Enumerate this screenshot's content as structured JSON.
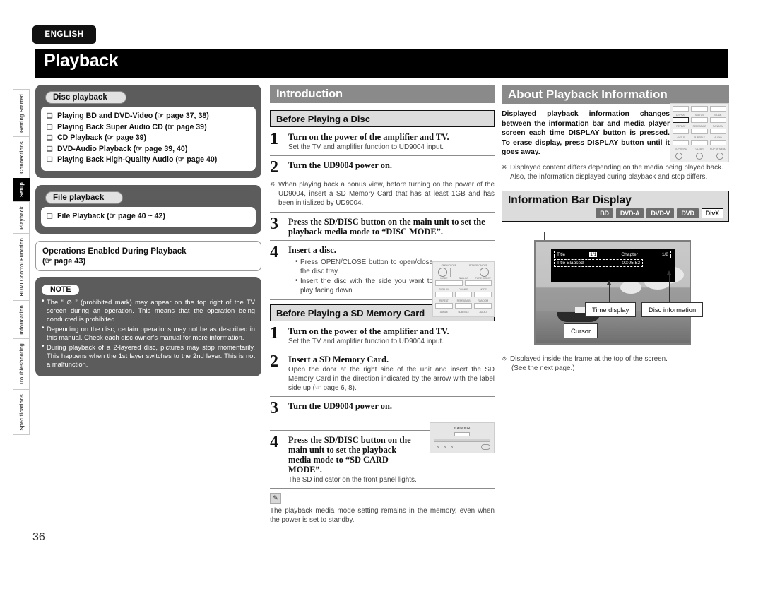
{
  "meta": {
    "page_number": "36",
    "language_badge": "ENGLISH",
    "page_title": "Playback"
  },
  "sidebar": {
    "items": [
      {
        "label": "Getting Started",
        "active": false
      },
      {
        "label": "Connections",
        "active": false
      },
      {
        "label": "Setup",
        "active": true
      },
      {
        "label": "Playback",
        "active": false
      },
      {
        "label": "HDMI Control Function",
        "active": false
      },
      {
        "label": "Information",
        "active": false
      },
      {
        "label": "Troubleshooting",
        "active": false
      },
      {
        "label": "Specifications",
        "active": false
      }
    ]
  },
  "left_column": {
    "disc_playback": {
      "pill": "Disc playback",
      "items": [
        "Playing BD and DVD-Video (☞ page 37, 38)",
        "Playing Back Super Audio CD (☞ page 39)",
        "CD Playback (☞ page 39)",
        "DVD-Audio Playback (☞ page 39, 40)",
        "Playing Back High-Quality Audio (☞ page 40)"
      ]
    },
    "file_playback": {
      "pill": "File playback",
      "items": [
        "File Playback (☞ page 40 ~ 42)"
      ]
    },
    "operations_box": {
      "title": "Operations Enabled During Playback",
      "reference": "(☞ page 43)"
    },
    "note": {
      "badge": "NOTE",
      "items": [
        "The “ ⊘ ” (prohibited mark) may appear on the top right of the TV screen during an operation. This means that the operation being conducted is prohibited.",
        "Depending on the disc, certain operations may not be as described in this manual. Check each disc owner’s manual for more information.",
        "During playback of a 2-layered disc, pictures may stop momentarily. This happens when the 1st layer switches to the 2nd layer. This is not a malfunction."
      ]
    }
  },
  "middle_column": {
    "section_title": "Introduction",
    "disc_section": {
      "heading": "Before Playing a Disc",
      "steps": [
        {
          "num": "1",
          "head": "Turn on the power of the amplifier and TV.",
          "body": "Set the TV and amplifier function to UD9004 input."
        },
        {
          "num": "2",
          "head": "Turn the UD9004 power on.",
          "body": ""
        },
        {
          "num": "3",
          "head": "Press the SD/DISC button on the main unit to set the playback media mode to “DISC MODE”.",
          "body": ""
        },
        {
          "num": "4",
          "head": "Insert a disc.",
          "body": ""
        }
      ],
      "note_after_step2": "When playing back a bonus view, before turning on the power of the UD9004, insert a SD Memory Card that has at least 1GB and has been initialized by UD9004.",
      "step4_bullets": [
        "Press OPEN/CLOSE button to open/close the disc tray.",
        "Insert the disc with the side you want to play facing down."
      ]
    },
    "sd_section": {
      "heading": "Before Playing a SD Memory Card",
      "steps": [
        {
          "num": "1",
          "head": "Turn on the power of the amplifier and TV.",
          "body": "Set the TV and amplifier function to UD9004 input."
        },
        {
          "num": "2",
          "head": "Insert a SD Memory Card.",
          "body": "Open the door at the right side of the unit and insert the SD Memory Card in the direction indicated by the arrow with the label side up (☞ page 6, 8)."
        },
        {
          "num": "3",
          "head": "Turn the UD9004 power on.",
          "body": ""
        },
        {
          "num": "4",
          "head": "Press the SD/DISC button on the main unit to set the playback media mode to “SD CARD MODE”.",
          "body": "The SD indicator on the front panel lights."
        }
      ]
    },
    "footer_note": "The playback media mode setting remains in the memory, even when the power is set to standby."
  },
  "right_column": {
    "section_title": "About Playback Information",
    "intro_bold": "Displayed playback information changes between the information bar and media player screen each time DISPLAY button is pressed. To erase display, press DISPLAY button until it goes away.",
    "note_lines": [
      "Displayed content differs depending on the media being played back.",
      "Also, the information displayed during playback and stop differs."
    ],
    "info_bar": {
      "heading": "Information Bar Display",
      "badges": [
        {
          "label": "BD",
          "style": "filled"
        },
        {
          "label": "DVD-A",
          "style": "filled"
        },
        {
          "label": "DVD-V",
          "style": "filled"
        },
        {
          "label": "DVD",
          "style": "filled"
        },
        {
          "label": "DivX",
          "style": "outline"
        }
      ]
    },
    "osd": {
      "title_label": "Title",
      "title_value": "1/1",
      "chapter_label": "Chapter",
      "chapter_value": "1/8",
      "elapsed_label": "Title Elapsed",
      "elapsed_value": "00:05:52"
    },
    "callouts": {
      "time_display": "Time display",
      "disc_information": "Disc information",
      "cursor": "Cursor"
    },
    "figure_note_line1": "Displayed inside the frame at the top of the screen.",
    "figure_note_line2": "(See the next page.)"
  },
  "remote_disc": {
    "rows": [
      [
        "OPEN/CLOSE",
        "POWER ON/OFF"
      ],
      [
        "MODE",
        "ANALOG",
        "PURE DIRECT"
      ],
      [
        "DISPLAY",
        "DIMMER",
        "MODE"
      ],
      [
        "REPEAT",
        "REPEAT A-B",
        "RANDOM"
      ],
      [
        "ANGLE",
        "SUBTITLE",
        "AUDIO"
      ]
    ]
  },
  "remote_display": {
    "rows": [
      [
        "DISPLAY",
        "STATUS",
        "MODE"
      ],
      [
        "REPEAT",
        "REPEAT A-B",
        "RANDOM"
      ],
      [
        "ANGLE",
        "SUBTITLE",
        "AUDIO"
      ],
      [
        "TOP MENU",
        "CLEAR",
        "POP UP MENU"
      ]
    ]
  },
  "unit_front": {
    "brand": "marantz"
  },
  "colors": {
    "grey_panel": "#5c5c5c",
    "section_header": "#8a8a8a",
    "subheader_bg": "#dcdcdc",
    "black": "#000000"
  }
}
